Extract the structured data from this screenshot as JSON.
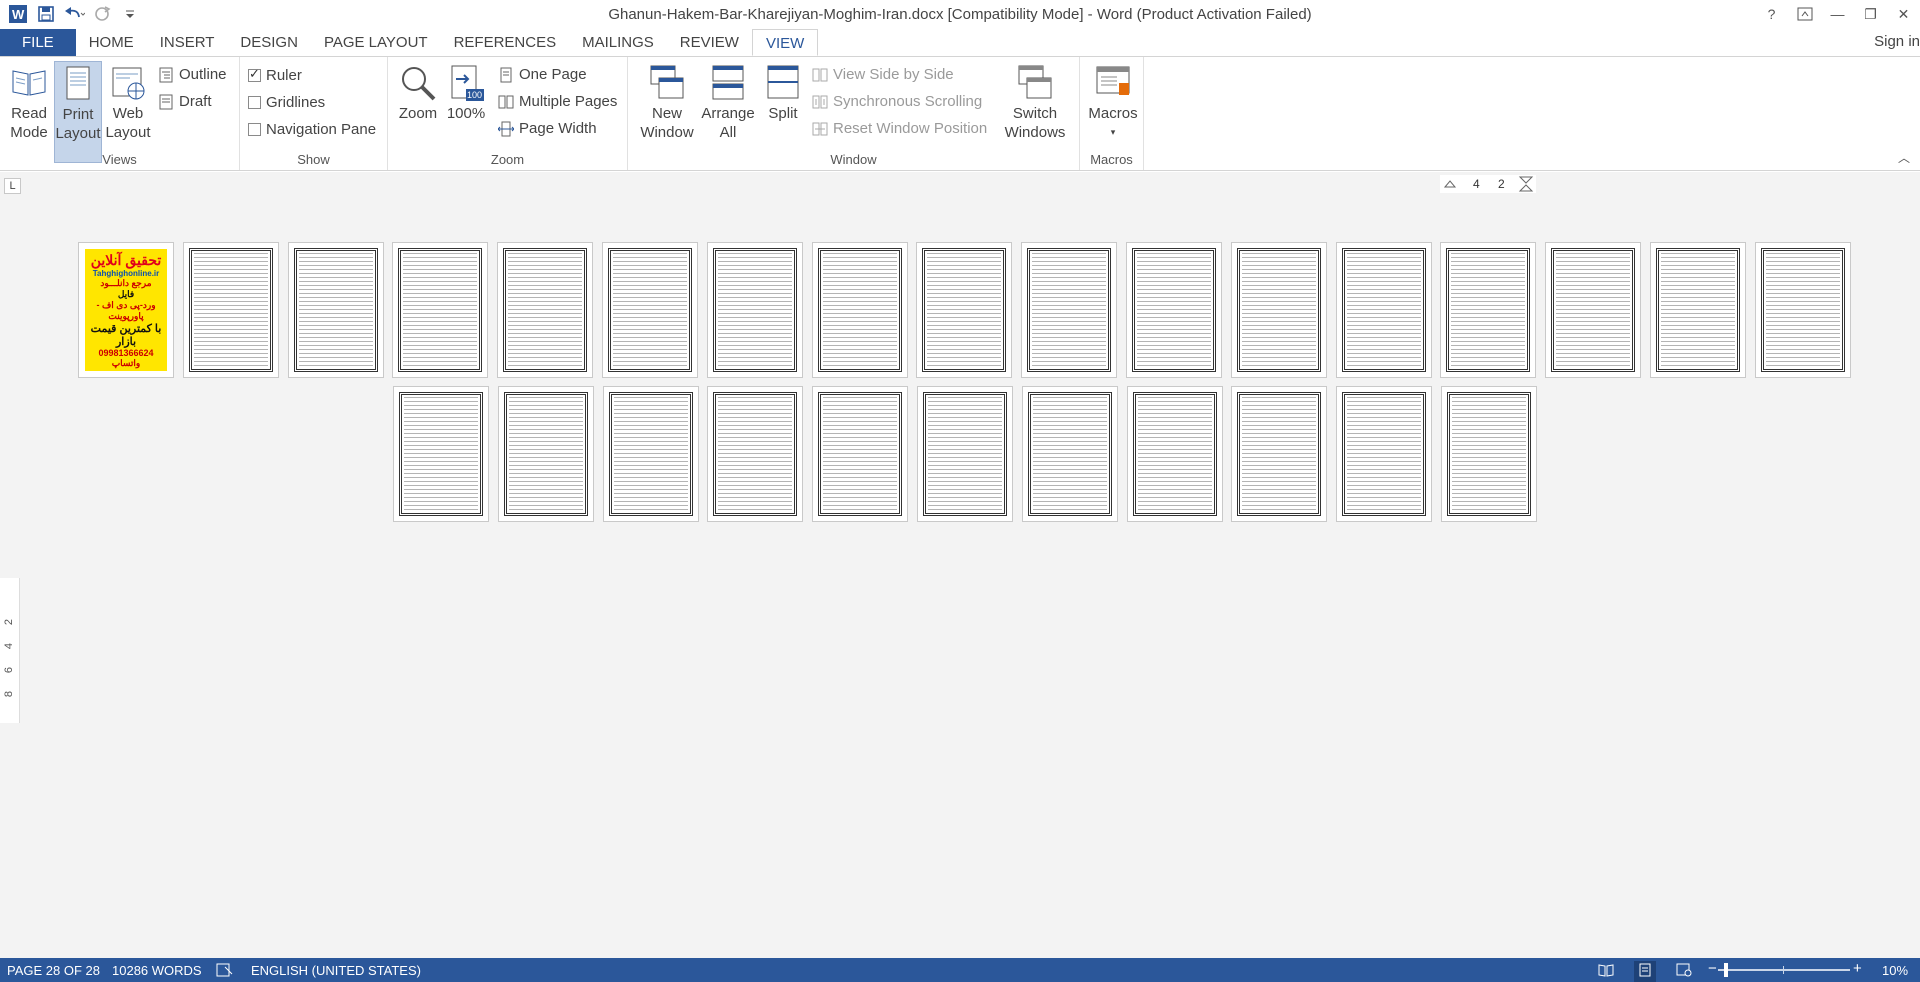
{
  "window": {
    "title": "Ghanun-Hakem-Bar-Kharejiyan-Moghim-Iran.docx [Compatibility Mode] - Word (Product Activation Failed)",
    "help": "?",
    "min": "—",
    "restore": "❐",
    "close": "✕"
  },
  "qat": {
    "save_icon": "save-icon",
    "undo_icon": "undo-icon",
    "redo_icon": "redo-icon"
  },
  "tabs": [
    "FILE",
    "HOME",
    "INSERT",
    "DESIGN",
    "PAGE LAYOUT",
    "REFERENCES",
    "MAILINGS",
    "REVIEW",
    "VIEW"
  ],
  "signin": "Sign in",
  "ribbon": {
    "views": {
      "label": "Views",
      "read_mode": "Read Mode",
      "print_layout": "Print Layout",
      "web_layout": "Web Layout",
      "outline": "Outline",
      "draft": "Draft"
    },
    "show": {
      "label": "Show",
      "ruler": "Ruler",
      "gridlines": "Gridlines",
      "nav_pane": "Navigation Pane"
    },
    "zoom": {
      "label": "Zoom",
      "zoom": "Zoom",
      "pct": "100%",
      "one_page": "One Page",
      "multiple_pages": "Multiple Pages",
      "page_width": "Page Width"
    },
    "window": {
      "label": "Window",
      "new_window": "New Window",
      "arrange_all": "Arrange All",
      "split": "Split",
      "side_by_side": "View Side by Side",
      "sync_scroll": "Synchronous Scrolling",
      "reset_pos": "Reset Window Position",
      "switch_windows": "Switch Windows"
    },
    "macros": {
      "label": "Macros",
      "macros": "Macros"
    }
  },
  "ruler": {
    "tab_selector": "L",
    "h_nums": [
      "4",
      "2"
    ],
    "v_nums": [
      "2",
      "4",
      "6",
      "8"
    ]
  },
  "cover": {
    "line1": "تحقیق آنلاین",
    "line2": "Tahghighonline.ir",
    "line3": "مرجع دانلـــود",
    "line4": "فایل",
    "line5": "ورد-پی دی اف - پاورپوینت",
    "line6": "با کمترین قیمت بازار",
    "line7": "09981366624 واتساپ"
  },
  "status": {
    "page": "PAGE 28 OF 28",
    "words": "10286 WORDS",
    "language": "ENGLISH (UNITED STATES)",
    "zoom": "10%"
  }
}
